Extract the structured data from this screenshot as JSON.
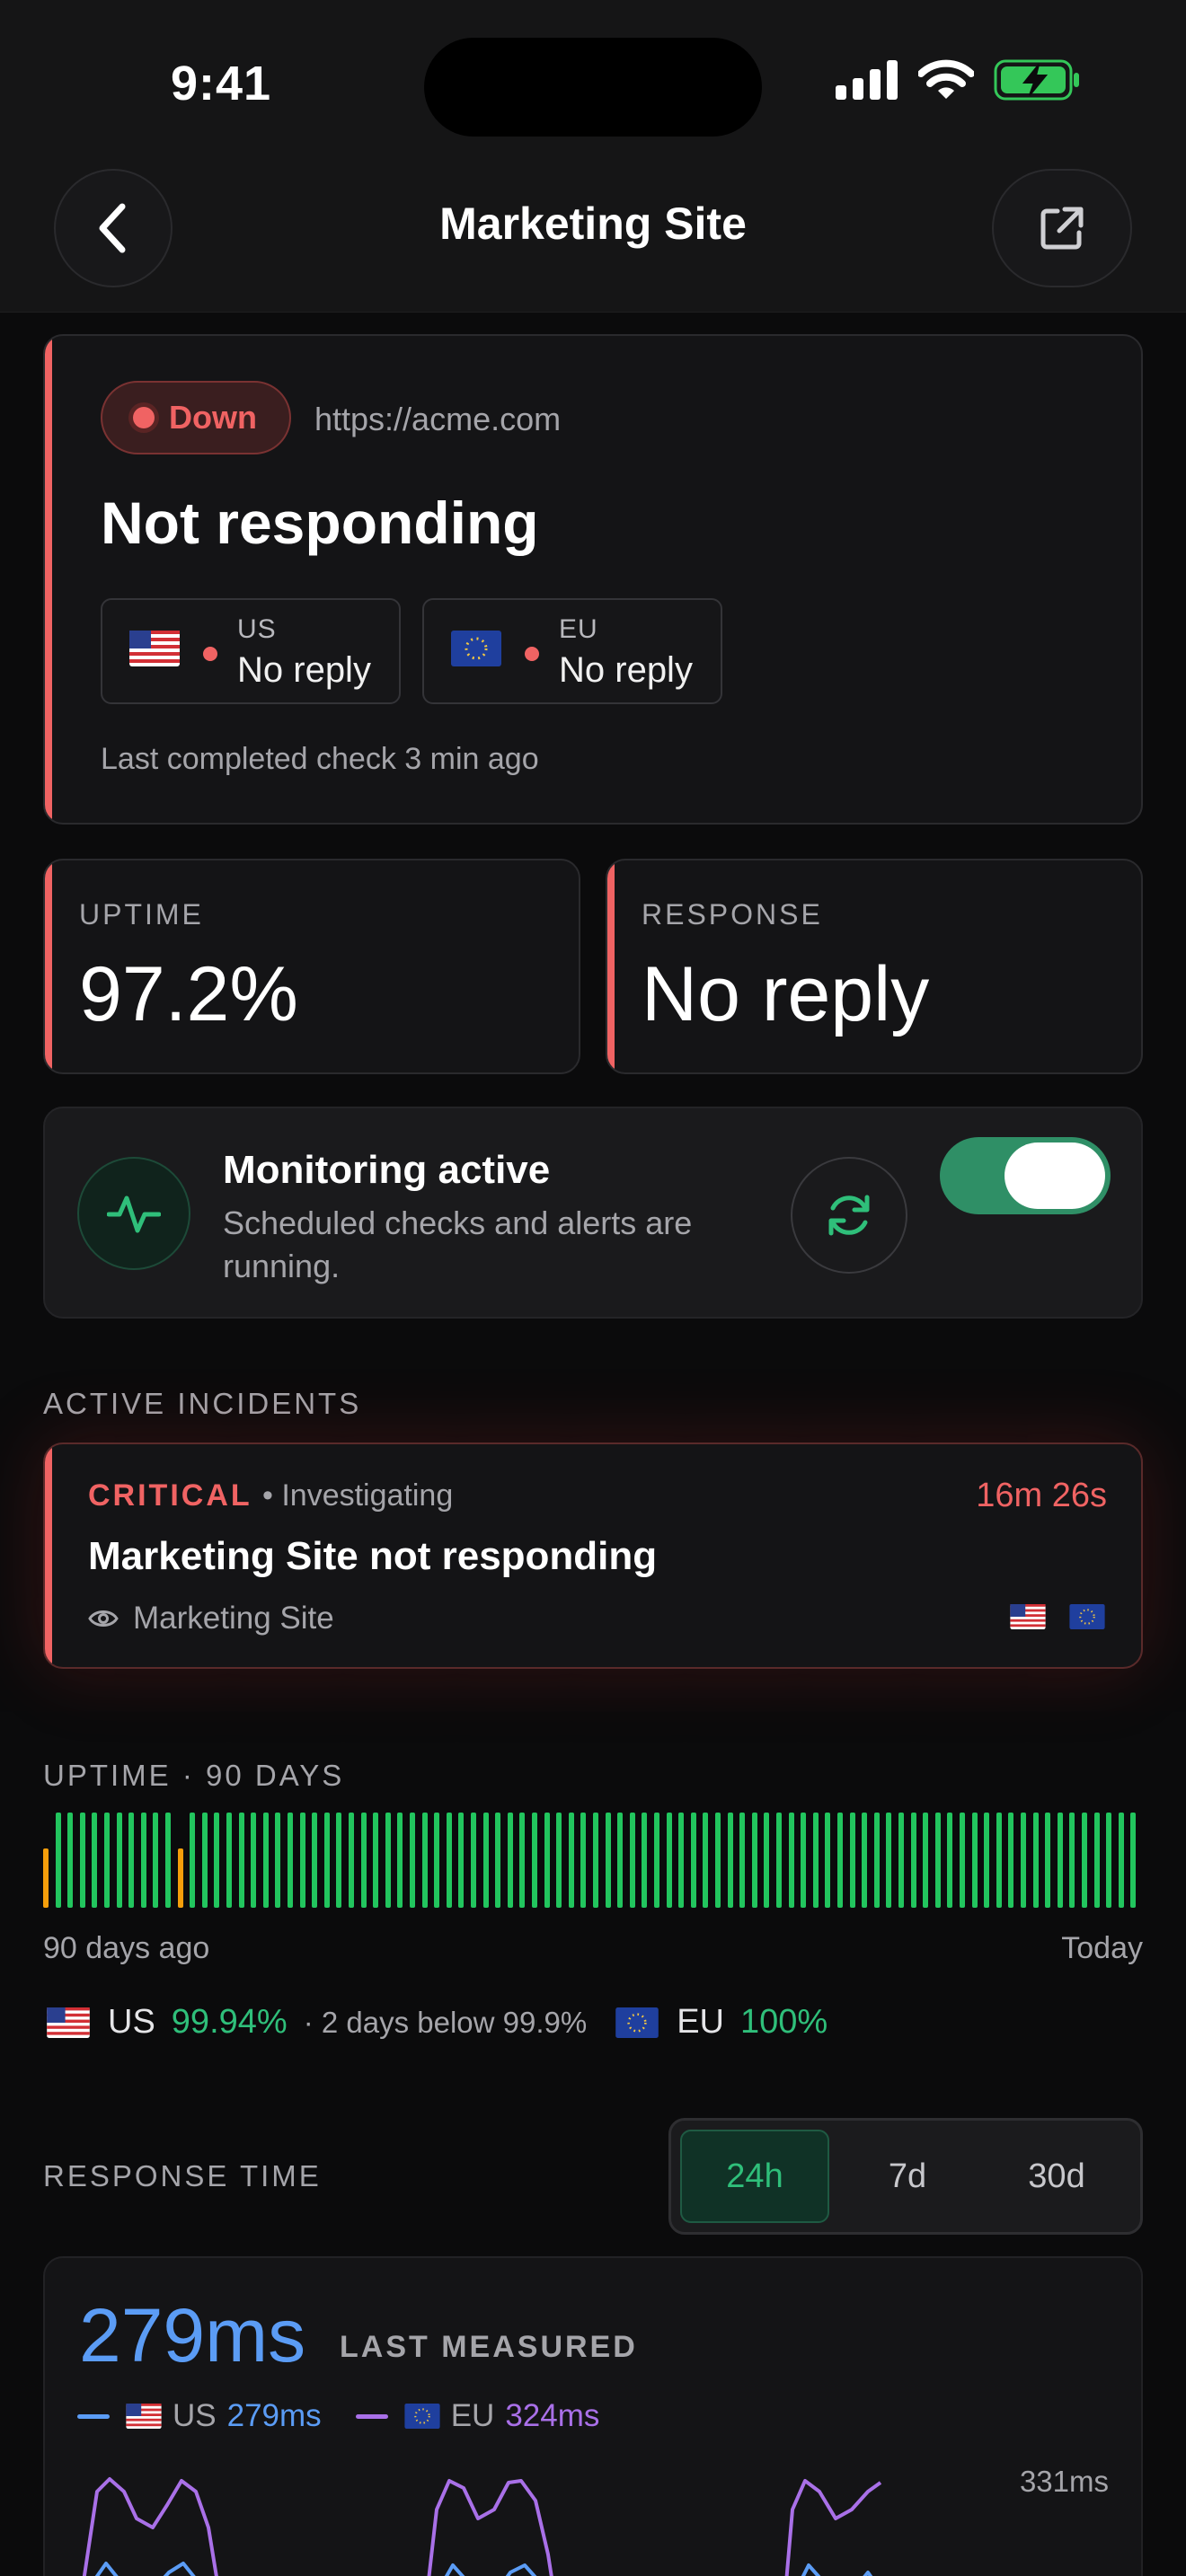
{
  "status_bar": {
    "time": "9:41"
  },
  "nav": {
    "title": "Marketing Site"
  },
  "hero": {
    "status_label": "Down",
    "url": "https://acme.com",
    "title": "Not responding",
    "regions": [
      {
        "code": "US",
        "value": "No reply",
        "flag": "us-flag"
      },
      {
        "code": "EU",
        "value": "No reply",
        "flag": "eu-flag"
      }
    ],
    "last_check": "Last completed check 3 min ago",
    "accent_color": "#f06363"
  },
  "stats": {
    "uptime": {
      "label": "UPTIME",
      "value": "97.2%"
    },
    "response": {
      "label": "RESPONSE",
      "value": "No reply"
    }
  },
  "monitoring": {
    "title": "Monitoring active",
    "subtitle": "Scheduled checks and alerts are running.",
    "enabled": true
  },
  "incidents": {
    "section_label": "ACTIVE INCIDENTS",
    "items": [
      {
        "severity": "CRITICAL",
        "status": "• Investigating",
        "duration": "16m 26s",
        "title": "Marketing Site not responding",
        "site": "Marketing Site"
      }
    ]
  },
  "uptime_history": {
    "section_label": "UPTIME · 90 DAYS",
    "start_label": "90 days ago",
    "end_label": "Today",
    "days": 90,
    "warning_days": [
      0,
      11
    ],
    "colors": {
      "ok": "#22c55e",
      "warn": "#f59e0b"
    },
    "summary": {
      "us_name": "US",
      "us_pct": "99.94%",
      "us_note": "· 2 days below 99.9%",
      "eu_name": "EU",
      "eu_pct": "100%"
    }
  },
  "response_time": {
    "section_label": "RESPONSE TIME",
    "ranges": [
      "24h",
      "7d",
      "30d"
    ],
    "active_range": "24h",
    "current": "279ms",
    "current_label": "LAST MEASURED",
    "legend": {
      "us_name": "US",
      "us_value": "279ms",
      "us_color": "#5b9cf5",
      "eu_name": "EU",
      "eu_value": "324ms",
      "eu_color": "#a970e8"
    },
    "axis_max_label": "331ms"
  }
}
